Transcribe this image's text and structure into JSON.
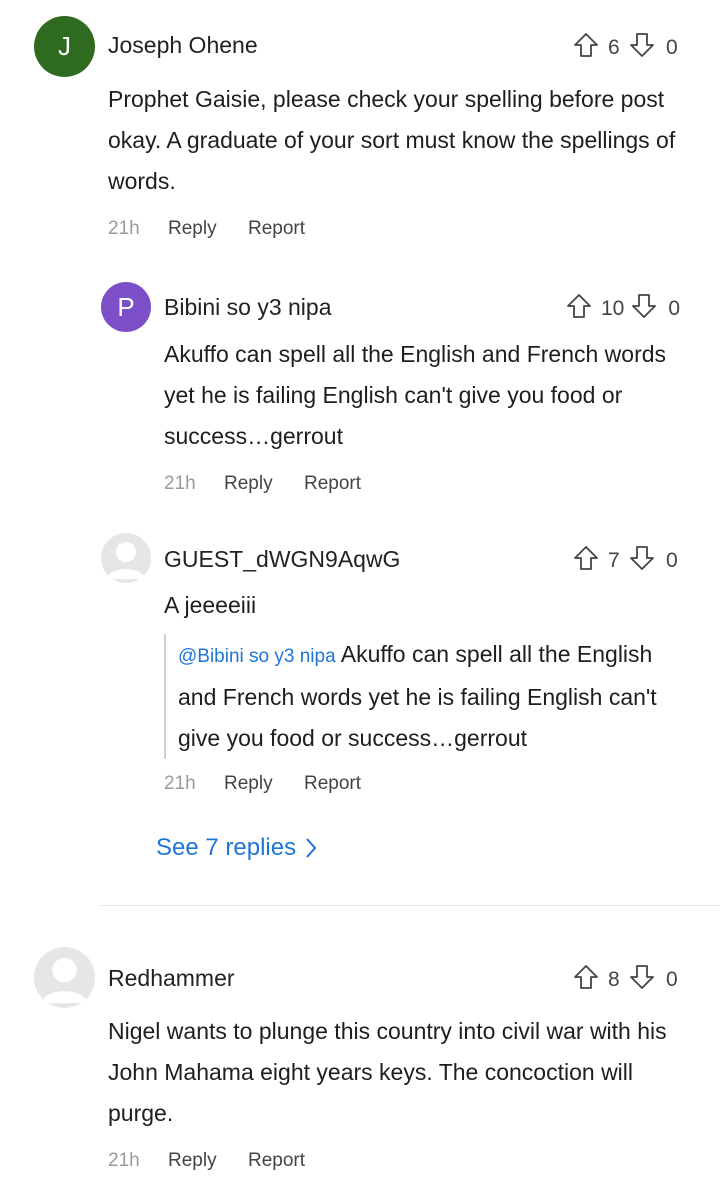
{
  "comments": [
    {
      "author": "Joseph Ohene",
      "avatar_letter": "J",
      "avatar_color": "#2e6b1f",
      "text": "Prophet Gaisie, please check your spelling before post okay. A graduate of your sort must know the spellings of words.",
      "upvotes": "6",
      "downvotes": "0",
      "time": "21h",
      "reply_label": "Reply",
      "report_label": "Report",
      "replies": [
        {
          "author": "Bibini so y3 nipa",
          "avatar_letter": "P",
          "avatar_color": "#7a4fc8",
          "text": "Akuffo can spell all the English and French words yet he is failing English can't give you food or success…gerrout",
          "upvotes": "10",
          "downvotes": "0",
          "time": "21h",
          "reply_label": "Reply",
          "report_label": "Report"
        },
        {
          "author": "GUEST_dWGN9AqwG",
          "text": "A jeeeeiii",
          "quote_mention": "@Bibini so y3 nipa",
          "quote_text": "Akuffo can spell all the English and French words yet he is failing English can't give you food or success…gerrout",
          "upvotes": "7",
          "downvotes": "0",
          "time": "21h",
          "reply_label": "Reply",
          "report_label": "Report"
        }
      ],
      "see_replies_label": "See 7 replies"
    },
    {
      "author": "Redhammer",
      "text": "Nigel wants to plunge this country into civil war with his John Mahama eight years keys. The concoction will purge.",
      "upvotes": "8",
      "downvotes": "0",
      "time": "21h",
      "reply_label": "Reply",
      "report_label": "Report"
    }
  ]
}
